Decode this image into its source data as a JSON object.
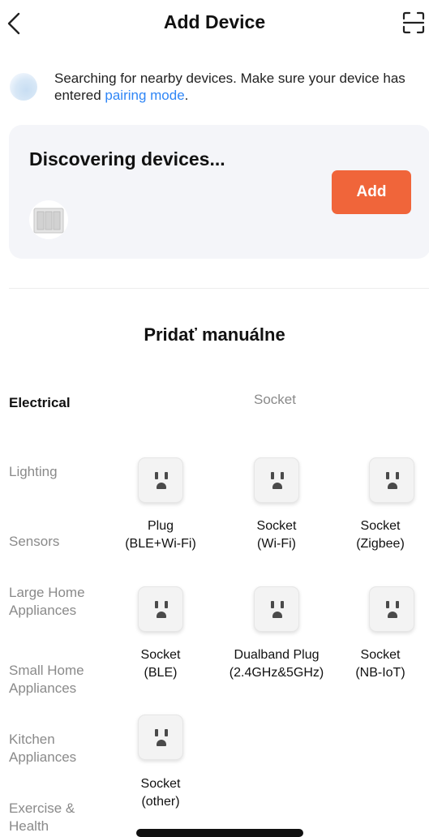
{
  "header": {
    "title": "Add Device"
  },
  "search": {
    "text_before": "Searching for nearby devices. Make sure your device has entered ",
    "link_text": "pairing mode",
    "text_after": "."
  },
  "discovery": {
    "title": "Discovering devices...",
    "add_label": "Add"
  },
  "manual": {
    "title": "Pridať manuálne"
  },
  "categories": [
    {
      "label": "Electrical",
      "active": true
    },
    {
      "label": "Lighting",
      "active": false
    },
    {
      "label": "Sensors",
      "active": false
    },
    {
      "label": "Large Home Appliances",
      "active": false
    },
    {
      "label": "Small Home Appliances",
      "active": false
    },
    {
      "label": "Kitchen Appliances",
      "active": false
    },
    {
      "label": "Exercise & Health",
      "active": false
    }
  ],
  "section": {
    "heading": "Socket"
  },
  "devices": [
    {
      "line1": "Plug",
      "line2": "(BLE+Wi-Fi)",
      "icon": "outlet-icon"
    },
    {
      "line1": "Socket",
      "line2": "(Wi-Fi)",
      "icon": "outlet-icon"
    },
    {
      "line1": "Socket",
      "line2": "(Zigbee)",
      "icon": "outlet-icon"
    },
    {
      "line1": "Socket",
      "line2": "(BLE)",
      "icon": "outlet-icon"
    },
    {
      "line1": "Dualband Plug",
      "line2": "(2.4GHz&5GHz)",
      "icon": "outlet-icon"
    },
    {
      "line1": "Socket",
      "line2": "(NB-IoT)",
      "icon": "outlet-icon"
    },
    {
      "line1": "Socket",
      "line2": "(other)",
      "icon": "outlet-icon"
    }
  ],
  "colors": {
    "accent": "#f0653a",
    "link": "#2f86f6",
    "card_bg": "#f4f5f9"
  }
}
